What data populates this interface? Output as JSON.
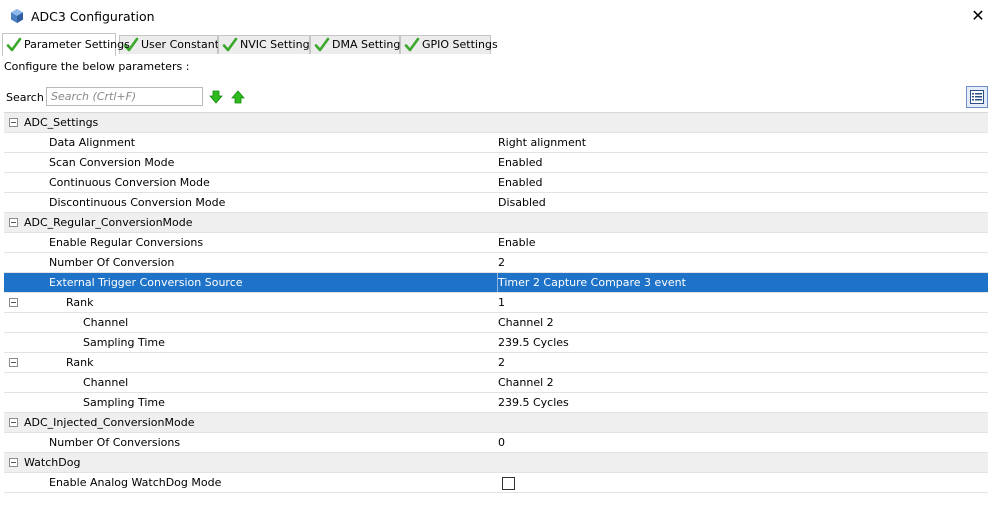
{
  "window": {
    "title": "ADC3 Configuration"
  },
  "tabs": [
    {
      "label": "Parameter Settings"
    },
    {
      "label": "User Constants"
    },
    {
      "label": "NVIC Settings"
    },
    {
      "label": "DMA Settings"
    },
    {
      "label": "GPIO Settings"
    }
  ],
  "panel": {
    "instruction": "Configure the below parameters :"
  },
  "search": {
    "label": "Search :",
    "placeholder": "Search (Crtl+F)"
  },
  "colors": {
    "selected_row": "#1e73c8",
    "check": "#3aa82a",
    "arrow": "#2dbb1f"
  },
  "rows": [
    {
      "name": "ADC_Settings",
      "value": ""
    },
    {
      "name": "Data Alignment",
      "value": "Right alignment"
    },
    {
      "name": "Scan Conversion Mode",
      "value": "Enabled"
    },
    {
      "name": "Continuous Conversion Mode",
      "value": "Enabled"
    },
    {
      "name": "Discontinuous Conversion Mode",
      "value": "Disabled"
    },
    {
      "name": "ADC_Regular_ConversionMode",
      "value": ""
    },
    {
      "name": "Enable Regular Conversions",
      "value": "Enable"
    },
    {
      "name": "Number Of Conversion",
      "value": "2"
    },
    {
      "name": "External Trigger Conversion Source",
      "value": "Timer 2 Capture Compare 3 event"
    },
    {
      "name": "Rank",
      "value": "1"
    },
    {
      "name": "Channel",
      "value": "Channel 2"
    },
    {
      "name": "Sampling Time",
      "value": "239.5 Cycles"
    },
    {
      "name": "Rank",
      "value": "2"
    },
    {
      "name": "Channel",
      "value": "Channel 2"
    },
    {
      "name": "Sampling Time",
      "value": "239.5 Cycles"
    },
    {
      "name": "ADC_Injected_ConversionMode",
      "value": ""
    },
    {
      "name": "Number Of Conversions",
      "value": "0"
    },
    {
      "name": "WatchDog",
      "value": ""
    },
    {
      "name": "Enable Analog WatchDog Mode",
      "value": ""
    }
  ]
}
